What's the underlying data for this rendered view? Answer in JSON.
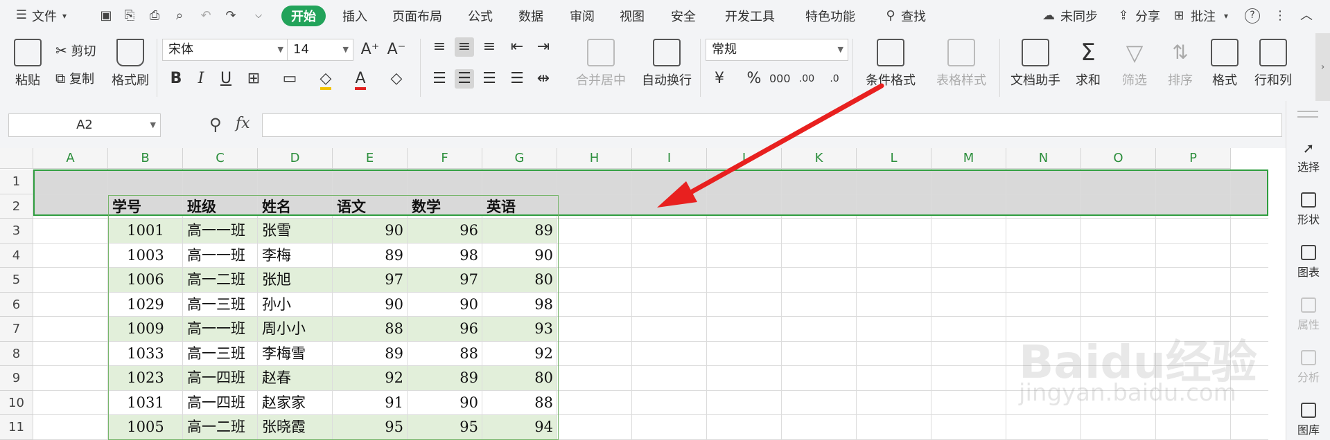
{
  "menubar": {
    "file_label": "文件",
    "tabs": [
      "开始",
      "插入",
      "页面布局",
      "公式",
      "数据",
      "审阅",
      "视图",
      "安全",
      "开发工具",
      "特色功能"
    ],
    "search_label": "查找",
    "unsynced_label": "未同步",
    "share_label": "分享",
    "comment_label": "批注"
  },
  "ribbon": {
    "paste": "粘贴",
    "cut": "剪切",
    "copy": "复制",
    "format_painter": "格式刷",
    "font_name": "宋体",
    "font_size": "14",
    "merge_center": "合并居中",
    "wrap_text": "自动换行",
    "number_format": "常规",
    "conditional_format": "条件格式",
    "table_style": "表格样式",
    "doc_assistant": "文档助手",
    "sum": "求和",
    "filter": "筛选",
    "sort": "排序",
    "format": "格式",
    "rows_cols": "行和列"
  },
  "formula_bar": {
    "name_box": "A2",
    "fx_label": "fx",
    "formula": ""
  },
  "grid": {
    "columns": [
      "A",
      "B",
      "C",
      "D",
      "E",
      "F",
      "G",
      "H",
      "I",
      "J",
      "K",
      "L",
      "M",
      "N",
      "O",
      "P"
    ],
    "rows": [
      "1",
      "2",
      "3",
      "4",
      "5",
      "6",
      "7",
      "8",
      "9",
      "10",
      "11"
    ],
    "headers": [
      "学号",
      "班级",
      "姓名",
      "语文",
      "数学",
      "英语"
    ],
    "records": [
      [
        "1001",
        "高一一班",
        "张雪",
        "90",
        "96",
        "89"
      ],
      [
        "1003",
        "高一一班",
        "李梅",
        "89",
        "98",
        "90"
      ],
      [
        "1006",
        "高一二班",
        "张旭",
        "97",
        "97",
        "80"
      ],
      [
        "1029",
        "高一三班",
        "孙小",
        "90",
        "90",
        "98"
      ],
      [
        "1009",
        "高一一班",
        "周小小",
        "88",
        "96",
        "93"
      ],
      [
        "1033",
        "高一三班",
        "李梅雪",
        "89",
        "88",
        "92"
      ],
      [
        "1023",
        "高一四班",
        "赵春",
        "92",
        "89",
        "80"
      ],
      [
        "1031",
        "高一四班",
        "赵家家",
        "91",
        "90",
        "88"
      ],
      [
        "1005",
        "高一二班",
        "张晓霞",
        "95",
        "95",
        "94"
      ]
    ]
  },
  "right_panel": {
    "items": [
      "选择",
      "形状",
      "图表",
      "属性",
      "分析",
      "图库"
    ]
  },
  "watermark": {
    "brand": "Baidu经验",
    "url": "jingyan.baidu.com"
  },
  "colors": {
    "accent": "#22a35a",
    "header_fill": "#d9d9d9",
    "band_fill": "#e2efda",
    "arrow": "#e8201f"
  }
}
